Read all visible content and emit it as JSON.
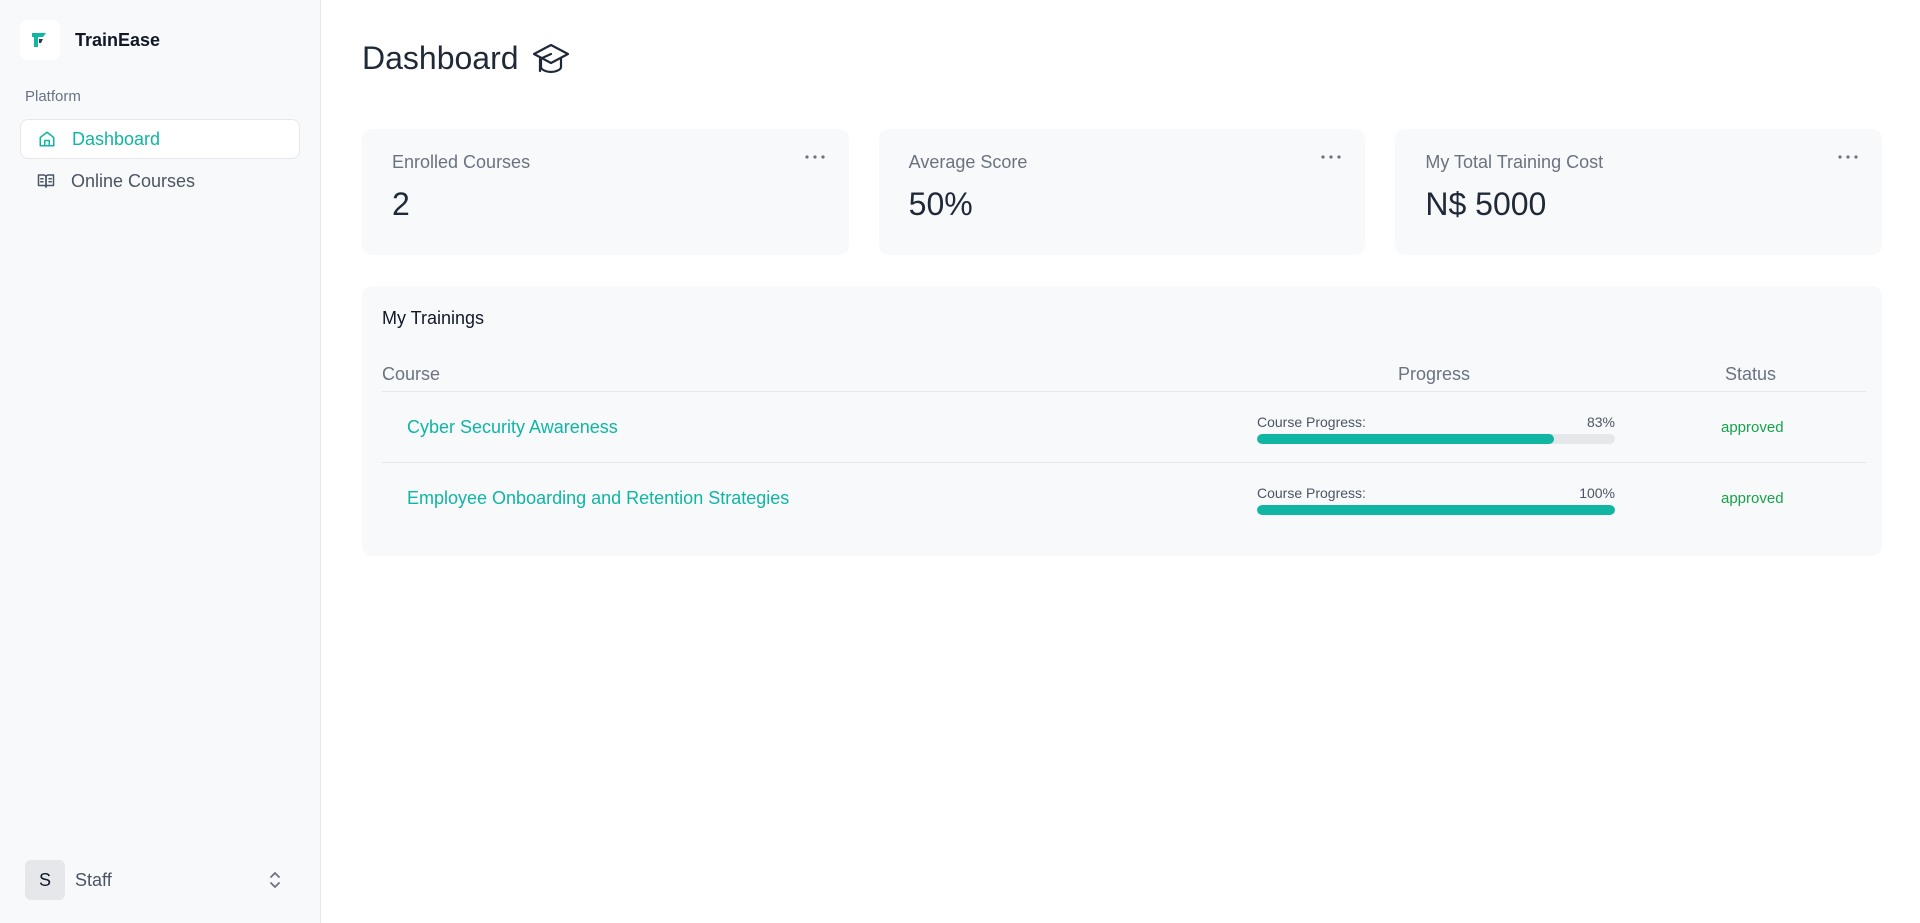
{
  "app": {
    "name": "TrainEase"
  },
  "sidebar": {
    "section_label": "Platform",
    "items": [
      {
        "label": "Dashboard",
        "icon": "home-icon",
        "active": true
      },
      {
        "label": "Online Courses",
        "icon": "book-open-icon",
        "active": false
      }
    ],
    "user": {
      "initial": "S",
      "name": "Staff"
    }
  },
  "header": {
    "title": "Dashboard",
    "icon": "graduation-cap-icon"
  },
  "stats": [
    {
      "label": "Enrolled Courses",
      "value": "2"
    },
    {
      "label": "Average Score",
      "value": "50%"
    },
    {
      "label": "My Total Training Cost",
      "value": "N$ 5000"
    }
  ],
  "trainings": {
    "title": "My Trainings",
    "columns": {
      "course": "Course",
      "progress": "Progress",
      "status": "Status"
    },
    "progress_label": "Course Progress:",
    "rows": [
      {
        "course": "Cyber Security Awareness",
        "progress_text": "83%",
        "progress": 83,
        "status": "approved"
      },
      {
        "course": "Employee Onboarding and Retention Strategies",
        "progress_text": "100%",
        "progress": 100,
        "status": "approved"
      }
    ]
  },
  "colors": {
    "accent": "#10b5a4",
    "status_approved": "#16a34a",
    "surface": "#f8f9fb"
  }
}
